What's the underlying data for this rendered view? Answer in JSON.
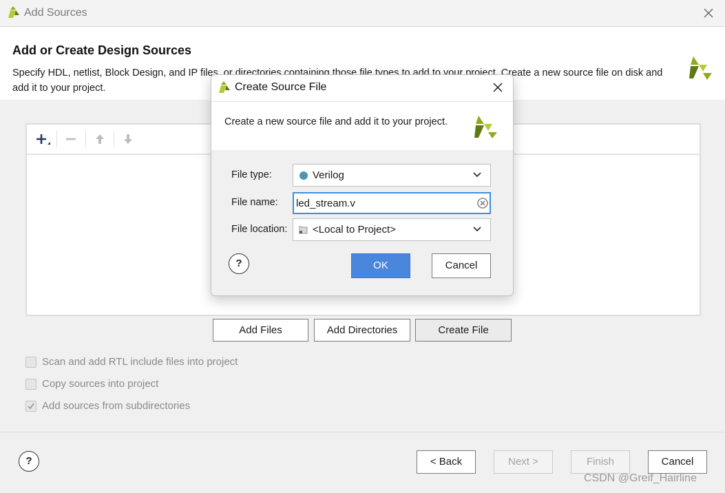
{
  "window": {
    "title": "Add Sources",
    "heading": "Add or Create Design Sources",
    "description": "Specify HDL, netlist, Block Design, and IP files, or directories containing those file types to add to your project. Create a new source file on disk and add it to your project."
  },
  "toolbar": {
    "add_icon": "plus-icon",
    "remove_icon": "minus-icon",
    "up_icon": "arrow-up-icon",
    "down_icon": "arrow-down-icon"
  },
  "actions": {
    "add_files": "Add Files",
    "add_directories": "Add Directories",
    "create_file": "Create File"
  },
  "options": {
    "scan_rtl": "Scan and add RTL include files into project",
    "copy_sources": "Copy sources into project",
    "add_subdirs": "Add sources from subdirectories"
  },
  "footer": {
    "help": "?",
    "back": "< Back",
    "next": "Next >",
    "finish": "Finish",
    "cancel": "Cancel"
  },
  "watermark": "CSDN @Greif_Hairline",
  "dialog": {
    "title": "Create Source File",
    "description": "Create a new source file and add it to your project.",
    "file_type_label": "File type:",
    "file_type_value": "Verilog",
    "file_name_label": "File name:",
    "file_name_value": "led_stream.v",
    "file_location_label": "File location:",
    "file_location_value": "<Local to Project>",
    "help": "?",
    "ok": "OK",
    "cancel": "Cancel"
  },
  "colors": {
    "accent": "#4a86db",
    "focus_border": "#3b8fd9",
    "verilog_dot": "#4d95b3",
    "logo_green": "#8dab1c",
    "logo_dark": "#5f7a10"
  }
}
